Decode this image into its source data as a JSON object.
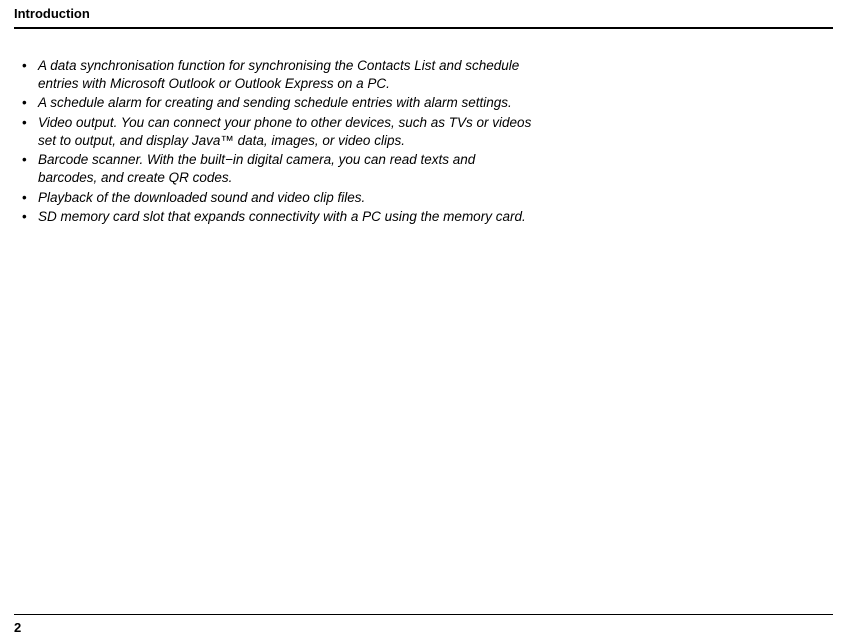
{
  "header": {
    "title": "Introduction"
  },
  "bullets": [
    "A data synchronisation function for synchronising the Contacts List and schedule entries with Microsoft Outlook or Outlook Express on a PC.",
    "A schedule alarm for creating and sending schedule entries with alarm settings.",
    "Video output. You can connect your phone to other devices, such as TVs or videos set to output, and display Java™ data, images, or video clips.",
    "Barcode scanner. With the built−in digital camera, you can read texts and barcodes, and create QR codes.",
    "Playback of the downloaded sound and video clip files.",
    "SD memory card slot that expands connectivity with a PC using the memory card."
  ],
  "footer": {
    "page_number": "2"
  }
}
